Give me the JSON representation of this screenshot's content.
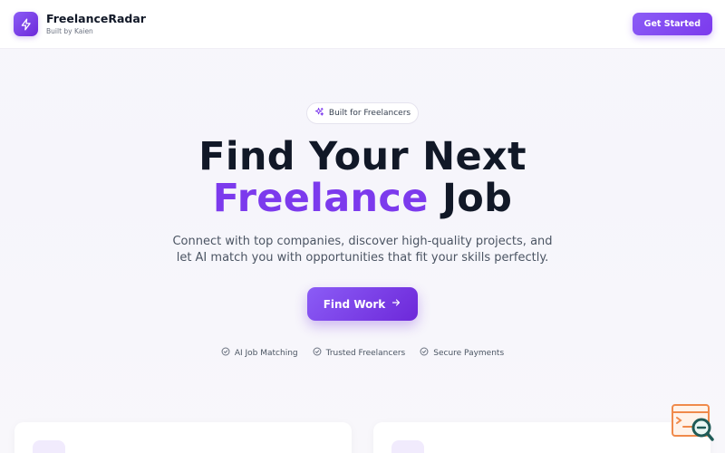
{
  "header": {
    "brand_name": "FreelanceRadar",
    "brand_sub": "Built by Kaien",
    "cta_label": "Get Started"
  },
  "hero": {
    "badge": "Built for Freelancers",
    "title_line1": "Find Your Next",
    "title_accent": "Freelance",
    "title_tail": "Job",
    "lead_line1": "Connect with top companies, discover high-quality projects, and",
    "lead_line2": "let AI match you with opportunities that fit your skills perfectly.",
    "find_label": "Find Work"
  },
  "features": [
    {
      "label": "AI Job Matching"
    },
    {
      "label": "Trusted Freelancers"
    },
    {
      "label": "Secure Payments"
    }
  ],
  "colors": {
    "accent": "#7c3aed",
    "accent_light": "#8b5cf6"
  },
  "icons": {
    "logo": "bolt-icon",
    "badge": "sparkles-icon",
    "find": "arrow-right-icon",
    "feature": "check-circle-icon"
  }
}
